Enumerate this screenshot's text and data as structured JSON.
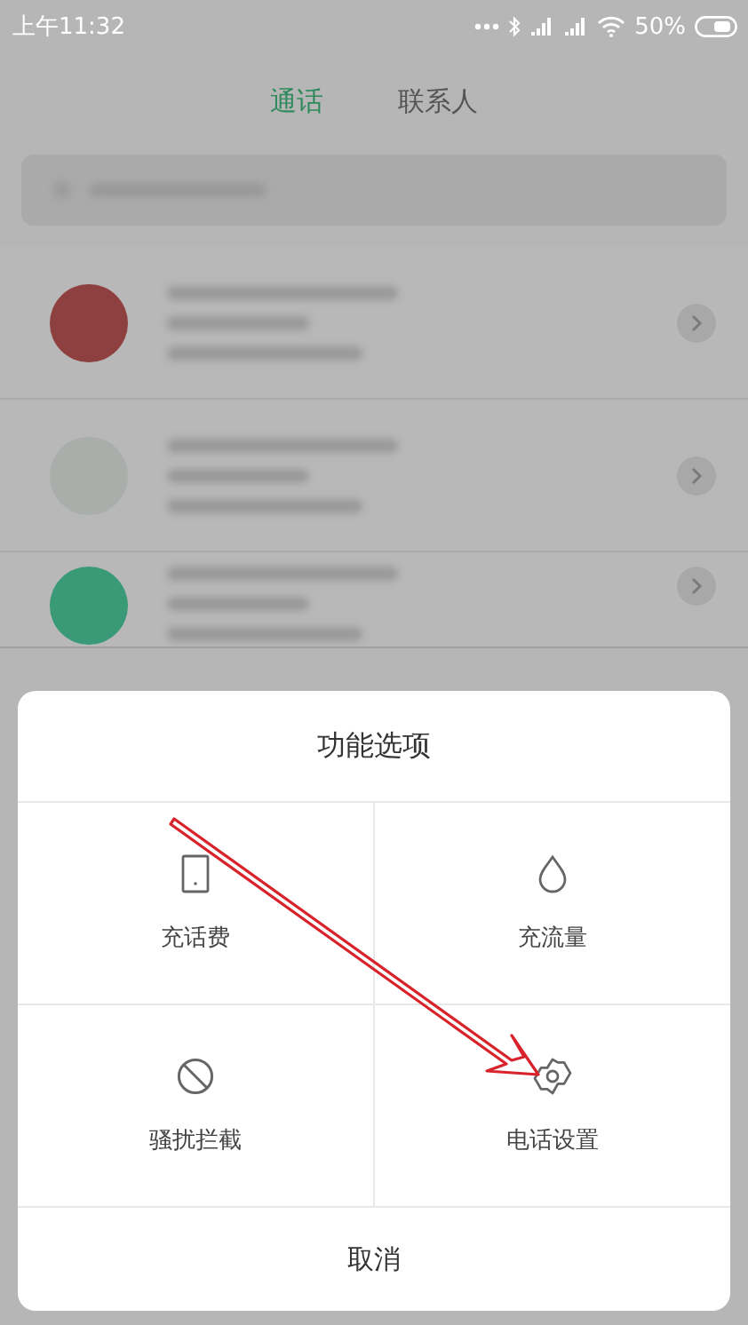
{
  "status_bar": {
    "time": "上午11:32",
    "battery": "50%"
  },
  "tabs": [
    {
      "label": "通话",
      "selected": true
    },
    {
      "label": "联系人",
      "selected": false
    }
  ],
  "contacts": [
    {
      "color": "#8e3f3f"
    },
    {
      "color": "#a9aeab"
    },
    {
      "color": "#3a9a78"
    }
  ],
  "dialog": {
    "title": "功能选项",
    "options": [
      {
        "label": "充话费",
        "kind": "phone"
      },
      {
        "label": "充流量",
        "kind": "drop"
      },
      {
        "label": "骚扰拦截",
        "kind": "block"
      },
      {
        "label": "电话设置",
        "kind": "gear"
      }
    ],
    "cancel": "取消"
  }
}
